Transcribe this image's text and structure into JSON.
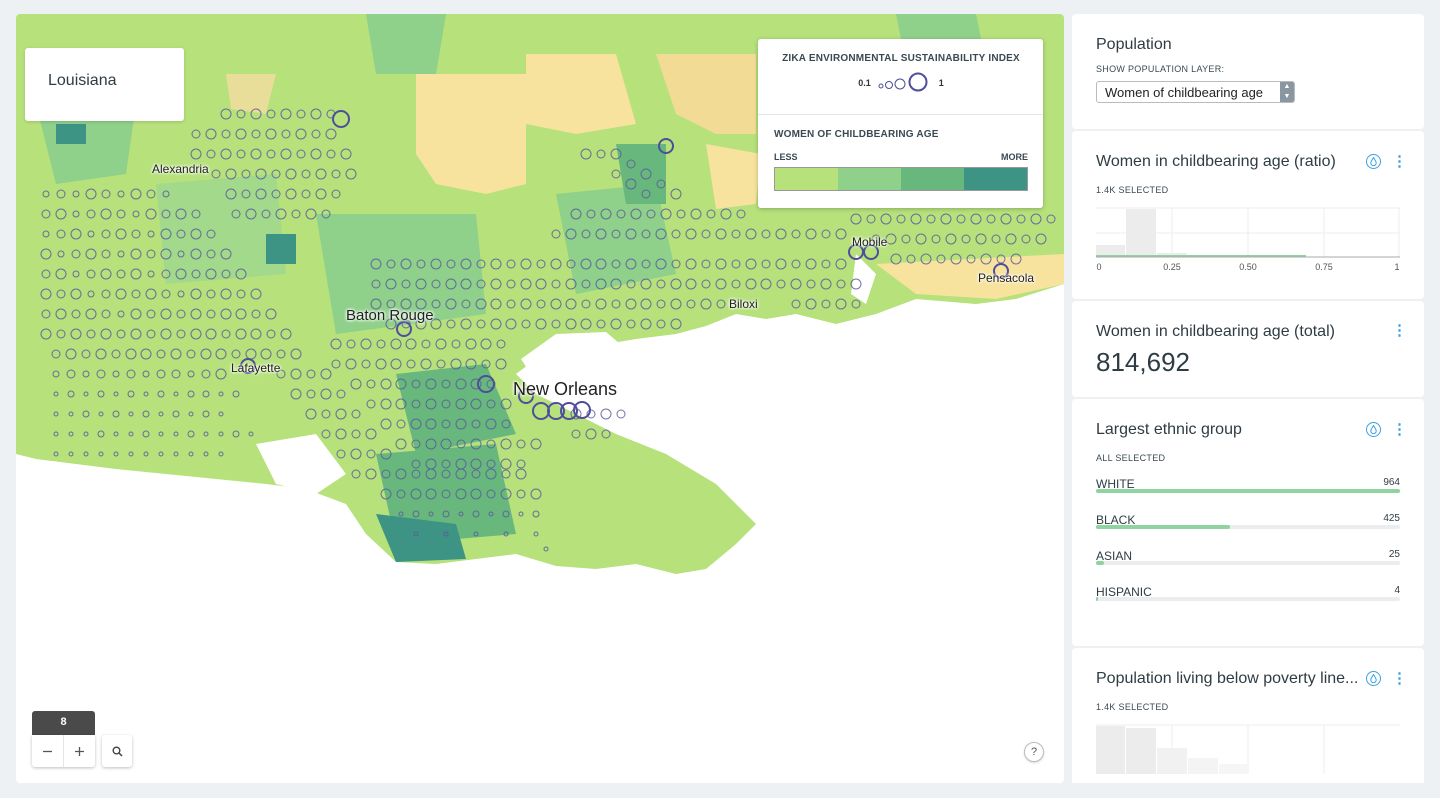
{
  "map": {
    "title": "Louisiana",
    "cities": [
      {
        "name": "Alexandria",
        "size": "sm"
      },
      {
        "name": "Baton Rouge",
        "size": "md"
      },
      {
        "name": "Lafayette",
        "size": "sm"
      },
      {
        "name": "New Orleans",
        "size": "lg"
      },
      {
        "name": "Biloxi",
        "size": "sm"
      },
      {
        "name": "Mobile",
        "size": "sm"
      },
      {
        "name": "Pensacola",
        "size": "sm"
      }
    ],
    "legend": {
      "bubble_title": "ZIKA ENVIRONMENTAL SUSTAINABILITY INDEX",
      "bubble_min": "0.1",
      "bubble_max": "1",
      "ramp_title": "WOMEN OF CHILDBEARING AGE",
      "ramp_low": "LESS",
      "ramp_high": "MORE",
      "ramp_colors": [
        "#b6e17b",
        "#8fd08a",
        "#68b87e",
        "#3d9384"
      ]
    },
    "zoom_level": "8",
    "help_label": "?",
    "colors": {
      "land_light": "#f7e39e",
      "land_green": "#b6e17b",
      "bubble": "#5a5a9a"
    }
  },
  "panel": {
    "population": {
      "title": "Population",
      "layer_label": "SHOW POPULATION LAYER:",
      "layer_value": "Women of childbearing age"
    },
    "ratio": {
      "title": "Women in childbearing age (ratio)",
      "selected": "1.4K SELECTED",
      "ticks": [
        "0",
        "0.25",
        "0.50",
        "0.75",
        "1"
      ]
    },
    "total": {
      "title": "Women in childbearing age (total)",
      "value": "814,692"
    },
    "ethnic": {
      "title": "Largest ethnic group",
      "selected": "ALL SELECTED",
      "items": [
        {
          "name": "WHITE",
          "count": "964",
          "fraction": 1.0
        },
        {
          "name": "BLACK",
          "count": "425",
          "fraction": 0.441
        },
        {
          "name": "ASIAN",
          "count": "25",
          "fraction": 0.026
        },
        {
          "name": "HISPANIC",
          "count": "4",
          "fraction": 0.004
        }
      ]
    },
    "poverty": {
      "title": "Population living below poverty line...",
      "selected": "1.4K SELECTED"
    }
  }
}
